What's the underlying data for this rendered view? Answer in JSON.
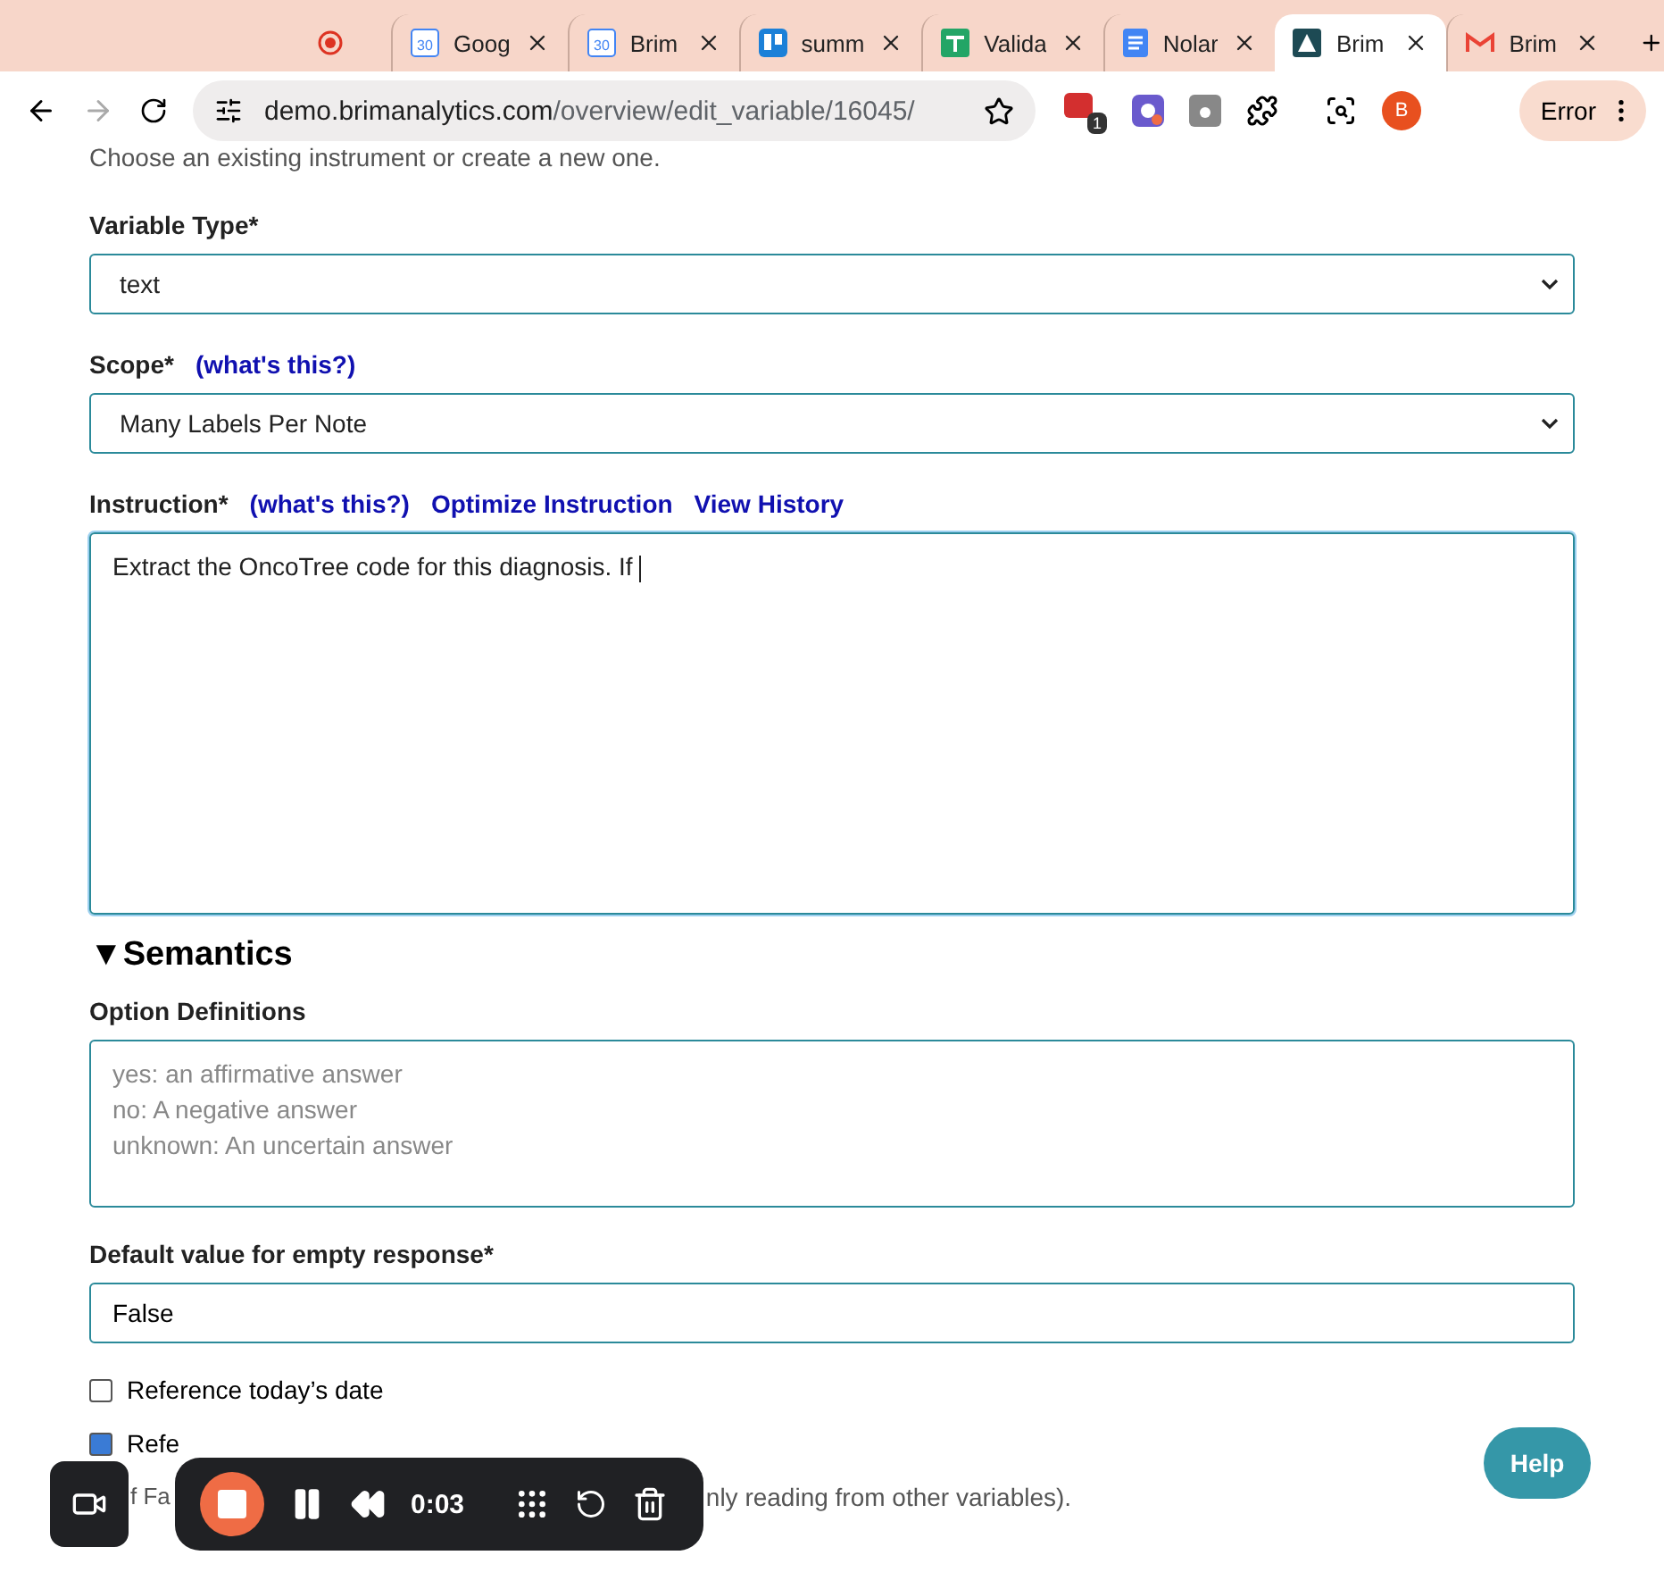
{
  "browser": {
    "tabs": [
      {
        "kind": "record",
        "selected": false
      },
      {
        "kind": "calendar",
        "day": "30",
        "label": "Goog",
        "selected": false
      },
      {
        "kind": "calendar",
        "day": "30",
        "label": "Brim",
        "selected": false
      },
      {
        "kind": "board",
        "label": "summ",
        "selected": false
      },
      {
        "kind": "sheet",
        "label": "Valida",
        "selected": false
      },
      {
        "kind": "doc",
        "label": "Nolar",
        "selected": false
      },
      {
        "kind": "brim",
        "label": "Brim",
        "selected": true
      },
      {
        "kind": "mail",
        "label": "Brim",
        "selected": false
      }
    ],
    "address": {
      "host": "demo.brimanalytics.com",
      "path": "/overview/edit_variable/16045/"
    },
    "extension_badge": "1",
    "profile": "B",
    "error_label": "Error"
  },
  "form": {
    "intro": "Choose an existing instrument or create a new one.",
    "variable_type": {
      "label": "Variable Type*",
      "value": "text"
    },
    "scope": {
      "label": "Scope*",
      "help": "(what's this?)",
      "value": "Many Labels Per Note"
    },
    "instruction": {
      "label": "Instruction*",
      "links": [
        "(what's this?)",
        "Optimize Instruction",
        "View History"
      ],
      "value": "Extract the OncoTree code for this diagnosis. If "
    },
    "semantics": {
      "marker": "▼",
      "title": "Semantics",
      "expanded": true
    },
    "option_definitions": {
      "label": "Option Definitions",
      "placeholder": "yes: an affirmative answer\nno: A negative answer\nunknown: An uncertain answer"
    },
    "default_value": {
      "label": "Default value for empty response*",
      "value": "False"
    },
    "checkboxes": [
      {
        "label": "Reference today’s date",
        "checked": false
      },
      {
        "label": "Refe",
        "checked": true
      }
    ],
    "note_parts": [
      "f Fa",
      "nly reading from other variables)."
    ]
  },
  "recorder": {
    "time": "0:03"
  },
  "help": "Help"
}
